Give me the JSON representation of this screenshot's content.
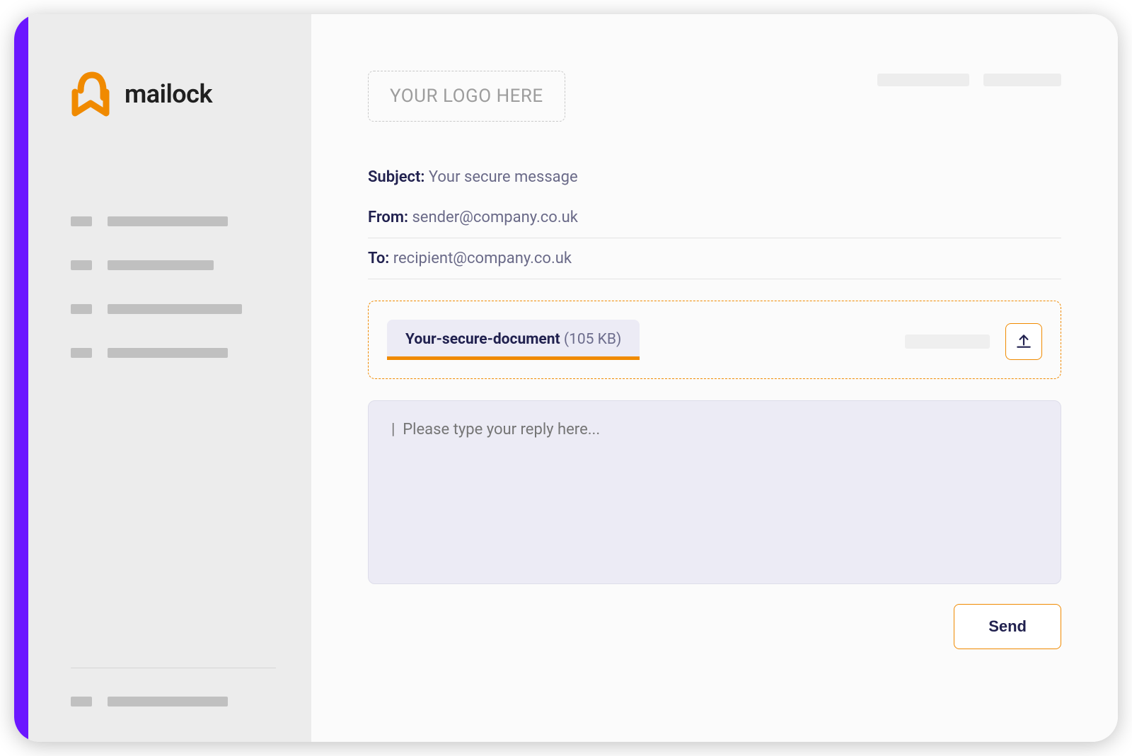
{
  "brand": {
    "name": "mailock",
    "accent_color": "#6b17ff",
    "icon_color": "#f08a00"
  },
  "logo_placeholder": "YOUR LOGO HERE",
  "message": {
    "subject_label": "Subject:",
    "subject_value": "Your secure message",
    "from_label": "From:",
    "from_value": "sender@company.co.uk",
    "to_label": "To:",
    "to_value": "recipient@company.co.uk"
  },
  "attachment": {
    "name": "Your-secure-document",
    "size": "(105 KB)"
  },
  "reply": {
    "placeholder": "|  Please type your reply here..."
  },
  "actions": {
    "send": "Send"
  }
}
